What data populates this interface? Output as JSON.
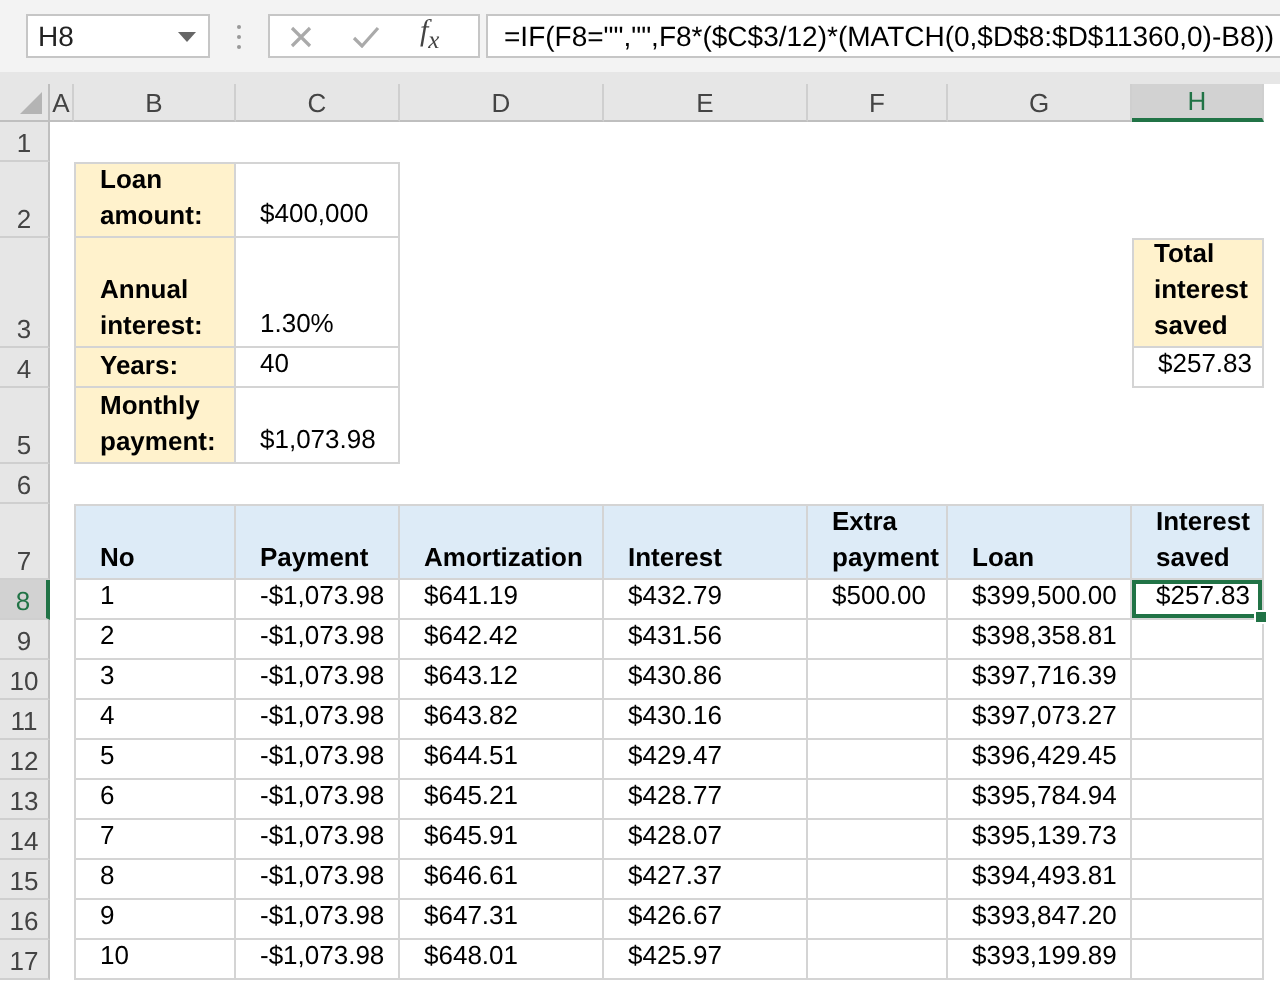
{
  "formula_bar": {
    "name_box": "H8",
    "function_button": "f$_{x}$",
    "formula": "=IF(F8=\"\",\"\",F8*($C$3/12)*(MATCH(0,$D$8:$D$11360,0)-B8))"
  },
  "column_headers": [
    {
      "label": "A",
      "selected": false
    },
    {
      "label": "B",
      "selected": false
    },
    {
      "label": "C",
      "selected": false
    },
    {
      "label": "D",
      "selected": false
    },
    {
      "label": "E",
      "selected": false
    },
    {
      "label": "F",
      "selected": false
    },
    {
      "label": "G",
      "selected": false
    },
    {
      "label": "H",
      "selected": true
    }
  ],
  "row_headers": [
    {
      "label": "1",
      "selected": false
    },
    {
      "label": "2",
      "selected": false
    },
    {
      "label": "3",
      "selected": false
    },
    {
      "label": "4",
      "selected": false
    },
    {
      "label": "5",
      "selected": false
    },
    {
      "label": "6",
      "selected": false
    },
    {
      "label": "7",
      "selected": false
    },
    {
      "label": "8",
      "selected": true
    },
    {
      "label": "9",
      "selected": false
    },
    {
      "label": "10",
      "selected": false
    },
    {
      "label": "11",
      "selected": false
    },
    {
      "label": "12",
      "selected": false
    },
    {
      "label": "13",
      "selected": false
    },
    {
      "label": "14",
      "selected": false
    },
    {
      "label": "15",
      "selected": false
    },
    {
      "label": "16",
      "selected": false
    },
    {
      "label": "17",
      "selected": false
    }
  ],
  "loan_inputs": [
    {
      "label": "Loan amount:",
      "value": "$400,000"
    },
    {
      "label": "Annual interest:",
      "value": "1.30%"
    },
    {
      "label": "Years:",
      "value": "40"
    },
    {
      "label": "Monthly payment:",
      "value": "$1,073.98"
    }
  ],
  "total_interest_saved": {
    "label": "Total interest saved",
    "value": "$257.83"
  },
  "schedule": {
    "columns": [
      "No",
      "Payment",
      "Amortization",
      "Interest",
      "Extra payment",
      "Loan",
      "Interest saved"
    ],
    "rows": [
      [
        {
          "text": "1",
          "selected": false
        },
        {
          "text": "-$1,073.98",
          "selected": false
        },
        {
          "text": "$641.19",
          "selected": false
        },
        {
          "text": "$432.79",
          "selected": false
        },
        {
          "text": "$500.00",
          "selected": false
        },
        {
          "text": "$399,500.00",
          "selected": false
        },
        {
          "text": "$257.83",
          "selected": true
        }
      ],
      [
        {
          "text": "2",
          "selected": false
        },
        {
          "text": "-$1,073.98",
          "selected": false
        },
        {
          "text": "$642.42",
          "selected": false
        },
        {
          "text": "$431.56",
          "selected": false
        },
        {
          "text": null,
          "selected": false
        },
        {
          "text": "$398,358.81",
          "selected": false
        },
        {
          "text": null,
          "selected": false
        }
      ],
      [
        {
          "text": "3",
          "selected": false
        },
        {
          "text": "-$1,073.98",
          "selected": false
        },
        {
          "text": "$643.12",
          "selected": false
        },
        {
          "text": "$430.86",
          "selected": false
        },
        {
          "text": null,
          "selected": false
        },
        {
          "text": "$397,716.39",
          "selected": false
        },
        {
          "text": null,
          "selected": false
        }
      ],
      [
        {
          "text": "4",
          "selected": false
        },
        {
          "text": "-$1,073.98",
          "selected": false
        },
        {
          "text": "$643.82",
          "selected": false
        },
        {
          "text": "$430.16",
          "selected": false
        },
        {
          "text": null,
          "selected": false
        },
        {
          "text": "$397,073.27",
          "selected": false
        },
        {
          "text": null,
          "selected": false
        }
      ],
      [
        {
          "text": "5",
          "selected": false
        },
        {
          "text": "-$1,073.98",
          "selected": false
        },
        {
          "text": "$644.51",
          "selected": false
        },
        {
          "text": "$429.47",
          "selected": false
        },
        {
          "text": null,
          "selected": false
        },
        {
          "text": "$396,429.45",
          "selected": false
        },
        {
          "text": null,
          "selected": false
        }
      ],
      [
        {
          "text": "6",
          "selected": false
        },
        {
          "text": "-$1,073.98",
          "selected": false
        },
        {
          "text": "$645.21",
          "selected": false
        },
        {
          "text": "$428.77",
          "selected": false
        },
        {
          "text": null,
          "selected": false
        },
        {
          "text": "$395,784.94",
          "selected": false
        },
        {
          "text": null,
          "selected": false
        }
      ],
      [
        {
          "text": "7",
          "selected": false
        },
        {
          "text": "-$1,073.98",
          "selected": false
        },
        {
          "text": "$645.91",
          "selected": false
        },
        {
          "text": "$428.07",
          "selected": false
        },
        {
          "text": null,
          "selected": false
        },
        {
          "text": "$395,139.73",
          "selected": false
        },
        {
          "text": null,
          "selected": false
        }
      ],
      [
        {
          "text": "8",
          "selected": false
        },
        {
          "text": "-$1,073.98",
          "selected": false
        },
        {
          "text": "$646.61",
          "selected": false
        },
        {
          "text": "$427.37",
          "selected": false
        },
        {
          "text": null,
          "selected": false
        },
        {
          "text": "$394,493.81",
          "selected": false
        },
        {
          "text": null,
          "selected": false
        }
      ],
      [
        {
          "text": "9",
          "selected": false
        },
        {
          "text": "-$1,073.98",
          "selected": false
        },
        {
          "text": "$647.31",
          "selected": false
        },
        {
          "text": "$426.67",
          "selected": false
        },
        {
          "text": null,
          "selected": false
        },
        {
          "text": "$393,847.20",
          "selected": false
        },
        {
          "text": null,
          "selected": false
        }
      ],
      [
        {
          "text": "10",
          "selected": false
        },
        {
          "text": "-$1,073.98",
          "selected": false
        },
        {
          "text": "$648.01",
          "selected": false
        },
        {
          "text": "$425.97",
          "selected": false
        },
        {
          "text": null,
          "selected": false
        },
        {
          "text": "$393,199.89",
          "selected": false
        },
        {
          "text": null,
          "selected": false
        }
      ]
    ]
  }
}
